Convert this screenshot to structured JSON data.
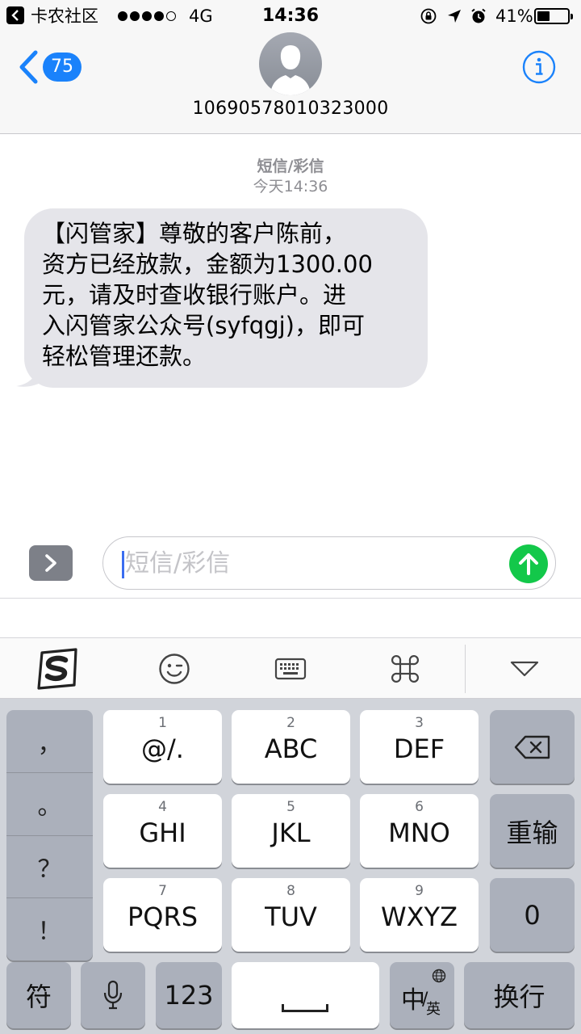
{
  "status_bar": {
    "carrier": "卡农社区",
    "network": "4G",
    "time": "14:36",
    "battery_percent": "41%",
    "battery_level": 0.41,
    "signal_bars_filled": 4,
    "signal_bars_total": 5,
    "icons": [
      "back-to-app-icon",
      "orientation-lock-icon",
      "location-arrow-icon",
      "alarm-icon",
      "battery-icon"
    ]
  },
  "header": {
    "back_badge": "75",
    "contact_number": "10690578010323000",
    "icons": [
      "chevron-left-icon",
      "person-avatar-icon",
      "info-icon"
    ]
  },
  "conversation": {
    "message_type": "短信/彩信",
    "timestamp": "今天14:36",
    "messages": [
      {
        "direction": "incoming",
        "text": "【闪管家】尊敬的客户陈前，\n资方已经放款，金额为1300.00\n元，请及时查收银行账户。进\n入闪管家公众号(syfqgj)，即可\n轻松管理还款。"
      }
    ]
  },
  "composer": {
    "placeholder": "短信/彩信",
    "icons": [
      "chevron-right-icon",
      "send-arrow-icon"
    ],
    "colors": {
      "send": "#13c84a",
      "caret": "#3a6df0"
    }
  },
  "ime_toolbar": {
    "icons": [
      "sogou-logo-icon",
      "emoji-icon",
      "keyboard-icon",
      "command-icon",
      "hide-keyboard-icon"
    ]
  },
  "keyboard": {
    "punctuation": [
      "，",
      "。",
      "？",
      "！"
    ],
    "keys": [
      {
        "digit": "1",
        "label": "@/."
      },
      {
        "digit": "2",
        "label": "ABC"
      },
      {
        "digit": "3",
        "label": "DEF"
      },
      {
        "digit": "4",
        "label": "GHI"
      },
      {
        "digit": "5",
        "label": "JKL"
      },
      {
        "digit": "6",
        "label": "MNO"
      },
      {
        "digit": "7",
        "label": "PQRS"
      },
      {
        "digit": "8",
        "label": "TUV"
      },
      {
        "digit": "9",
        "label": "WXYZ"
      }
    ],
    "retype": "重输",
    "zero": "0",
    "symbols": "符",
    "numbers": "123",
    "lang_zh": "中",
    "lang_slash": "/",
    "lang_en": "英",
    "return": "换行"
  },
  "colors": {
    "accent": "#1a82fb",
    "incoming_bubble": "#e5e5ea",
    "meta_text": "#8e8e93"
  }
}
